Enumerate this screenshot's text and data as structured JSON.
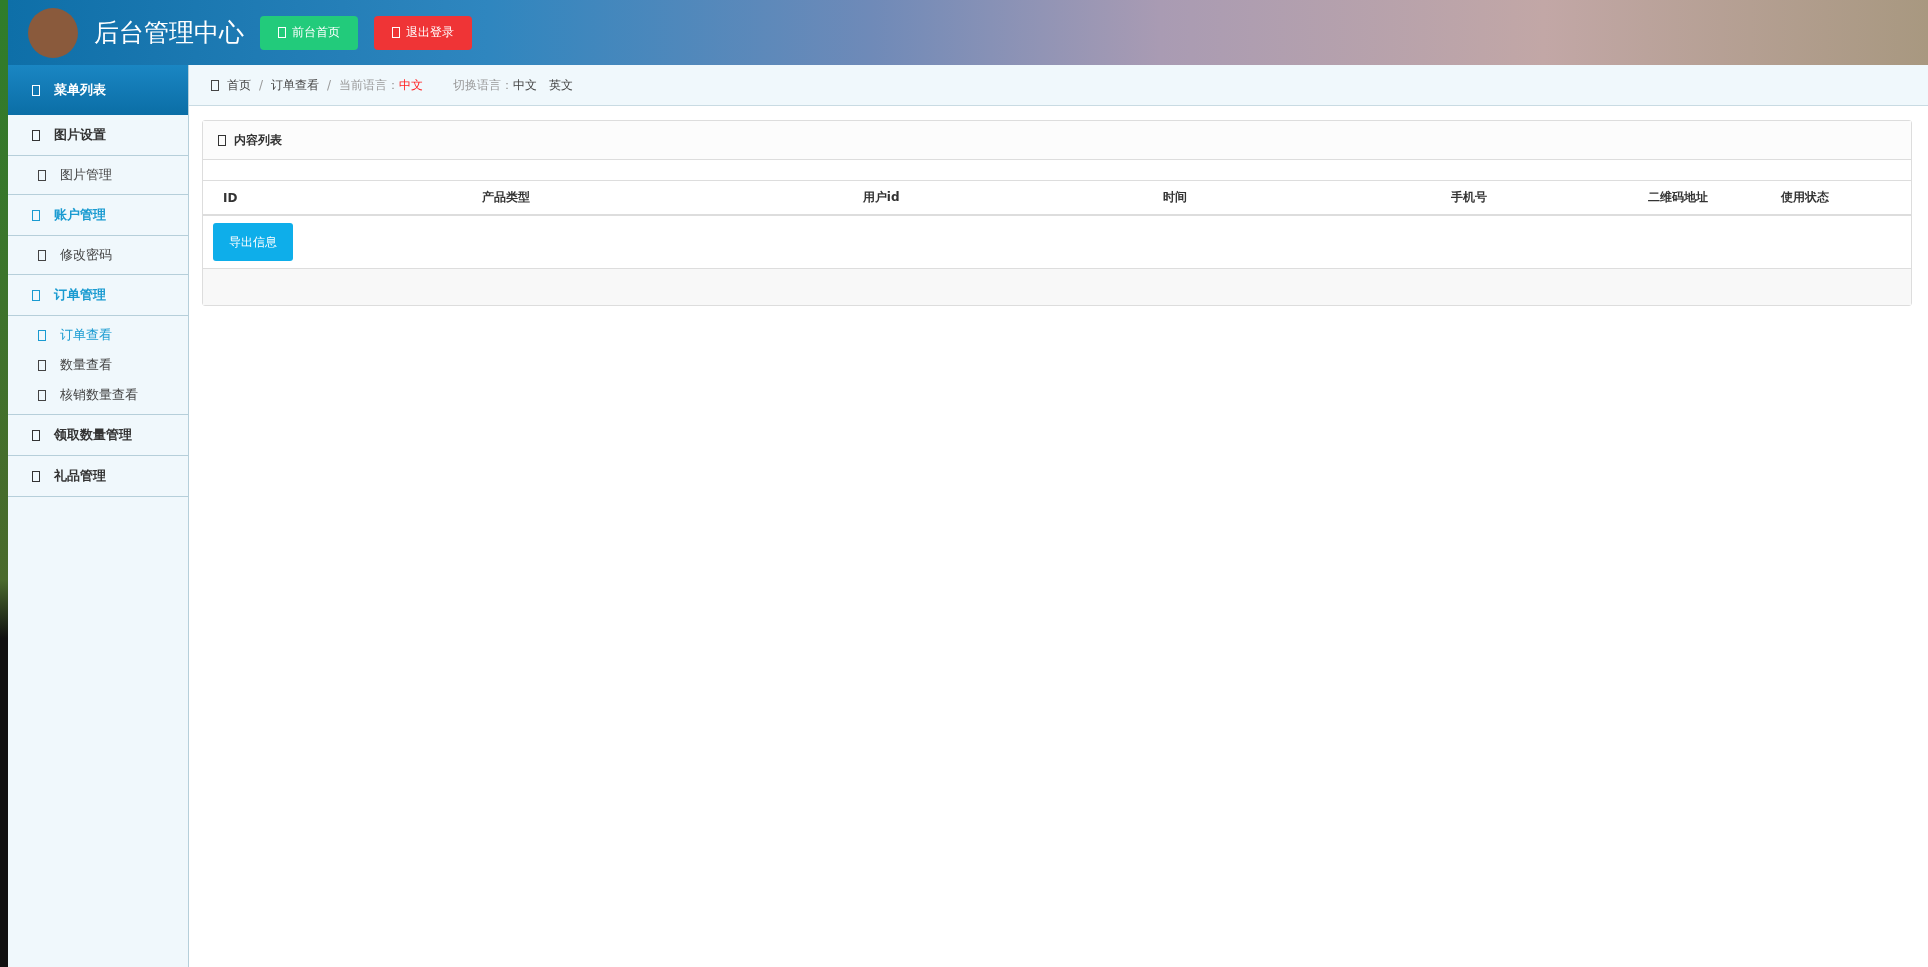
{
  "header": {
    "title": "后台管理中心",
    "buttons": [
      {
        "label": "前台首页",
        "kind": "home"
      },
      {
        "label": "退出登录",
        "kind": "logout"
      }
    ]
  },
  "sidebar": {
    "title": "菜单列表",
    "groups": [
      {
        "label": "图片设置",
        "active": false,
        "children": [
          {
            "label": "图片管理",
            "selected": false
          }
        ]
      },
      {
        "label": "账户管理",
        "active": true,
        "children": [
          {
            "label": "修改密码",
            "selected": false
          }
        ]
      },
      {
        "label": "订单管理",
        "active": true,
        "children": [
          {
            "label": "订单查看",
            "selected": true
          },
          {
            "label": "数量查看",
            "selected": false
          },
          {
            "label": "核销数量查看",
            "selected": false
          }
        ]
      },
      {
        "label": "领取数量管理",
        "active": false
      },
      {
        "label": "礼品管理",
        "active": false
      }
    ]
  },
  "breadcrumb": {
    "items": [
      "首页",
      "订单查看"
    ],
    "separator": "/",
    "current_language_label": "当前语言：",
    "current_language": "中文",
    "switch_label": "切换语言：",
    "languages": [
      "中文",
      "英文"
    ]
  },
  "panel": {
    "title": "内容列表",
    "columns": [
      "ID",
      "产品类型",
      "用户id",
      "时间",
      "手机号",
      "二维码地址",
      "使用状态"
    ],
    "export_button": "导出信息"
  }
}
